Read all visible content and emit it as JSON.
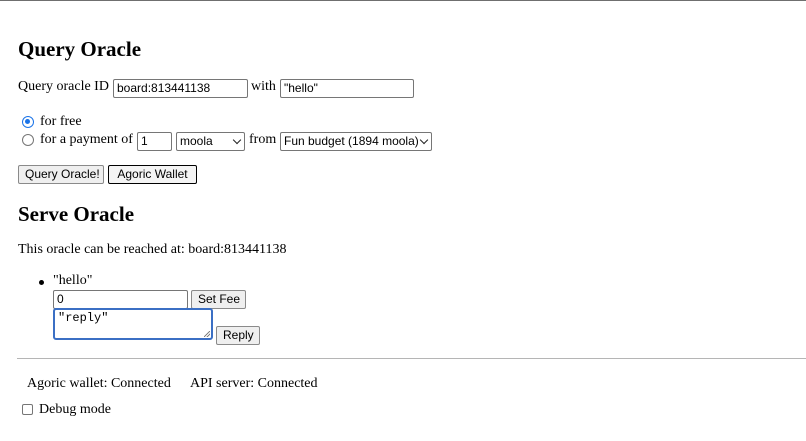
{
  "query": {
    "title": "Query Oracle",
    "id_label": "Query oracle ID",
    "oracle_id_value": "board:813441138",
    "with_label": "with",
    "query_value": "\"hello\"",
    "free_label": "for free",
    "payment_label": "for a payment of",
    "amount_value": "1",
    "brand_selected": "moola",
    "from_label": "from",
    "purse_selected": "Fun budget (1894 moola)",
    "query_button": "Query Oracle!",
    "wallet_button": "Agoric Wallet"
  },
  "serve": {
    "title": "Serve Oracle",
    "reach_text": "This oracle can be reached at: board:813441138",
    "requests": [
      {
        "query": "\"hello\"",
        "fee_value": "0",
        "set_fee_button": "Set Fee",
        "reply_value": "\"reply\"",
        "reply_button": "Reply"
      }
    ]
  },
  "status": {
    "wallet": "Agoric wallet: Connected",
    "api": "API server: Connected"
  },
  "debug": {
    "label": "Debug mode"
  },
  "colors": {
    "radio_accent": "#1a73e8",
    "focus_border": "#3b6fc4"
  },
  "icons": {
    "select_arrow": "chevron-down-icon",
    "resize_handle": "resize-grip-icon"
  }
}
